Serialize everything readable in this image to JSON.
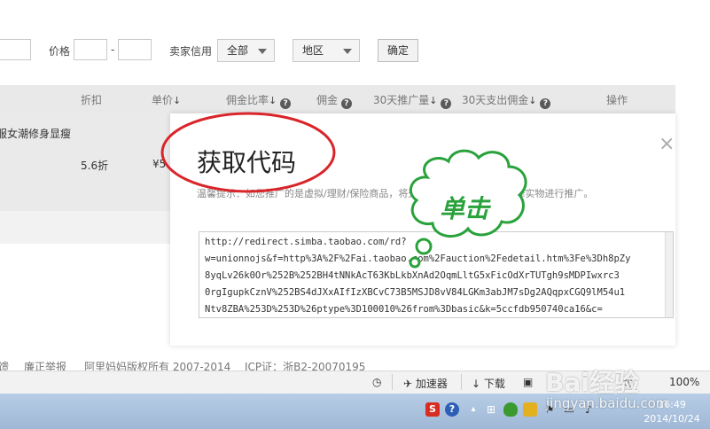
{
  "filter": {
    "price_label": "价格",
    "price_separator": "-",
    "seller_credit_label": "卖家信用",
    "credit_value": "全部",
    "region_value": "地区",
    "confirm_label": "确定"
  },
  "table": {
    "headers": [
      {
        "label": "折扣"
      },
      {
        "label": "单价",
        "sort": "↓"
      },
      {
        "label": "佣金比率",
        "sort": "↓"
      },
      {
        "label": "佣金"
      },
      {
        "label": "30天推广量",
        "sort": "↓"
      },
      {
        "label": "30天支出佣金",
        "sort": "↓"
      },
      {
        "label": "操作"
      }
    ],
    "row": {
      "title": "服女潮修身显瘦",
      "discount": "5.6折",
      "price": "¥5"
    }
  },
  "footer": {
    "link1": "馈",
    "link2": "廉正举报",
    "copyright": "阿里妈妈版权所有 2007-2014",
    "icp": "ICP证：浙B2-20070195"
  },
  "modal": {
    "title": "获取代码",
    "close": "×",
    "tip": "温馨提示：如您推广的是虚拟/理财/保险商品，将无法获得佣金，建议您选择实物进行推广。",
    "code_lines": [
      "http://redirect.simba.taobao.com/rd?",
      "w=unionnojs&f=http%3A%2F%2Fai.taobao.com%2Fauction%2Fedetail.htm%3Fe%3Dh8pZy",
      "8yqLv26k0Or%252B%252BH4tNNkAcT63KbLkbXnAd2OqmLltG5xFicOdXrTUTgh9sMDPIwxrc3",
      "0rgIgupkCznV%252BS4dJXxAIfIzXBCvC73B5MSJD8vV84LGKm3abJM7sDg2AQqpxCGQ9lM54u1",
      "Ntv8ZBA%253D%253D%26ptype%3D100010%26from%3Dbasic&k=5ccfdb950740ca16&c="
    ]
  },
  "annotation": {
    "callout_text": "单击",
    "colors": {
      "ellipse": "#d9252a",
      "cloud": "#2aa23c"
    }
  },
  "statusbar": {
    "accelerator": "加速器",
    "download": "下载",
    "zoom": "100%"
  },
  "taskbar": {
    "time": "16:49",
    "date": "2014/10/24"
  },
  "watermark": {
    "brand": "Bai经验",
    "url": "jingyan.baidu.com"
  }
}
